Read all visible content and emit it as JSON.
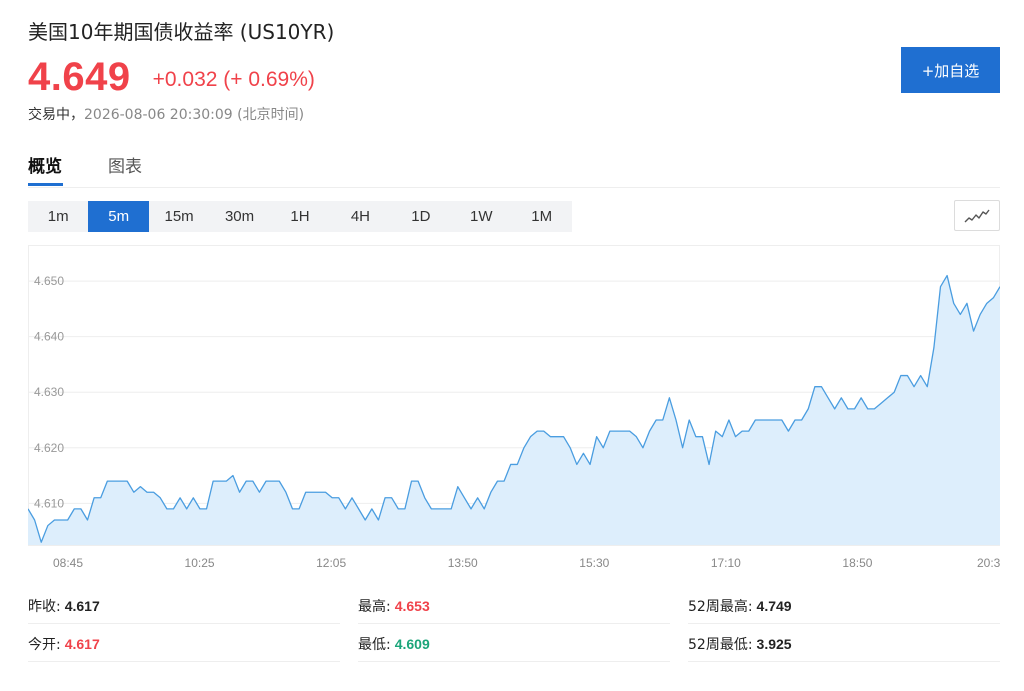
{
  "header": {
    "title": "美国10年期国债收益率 (US10YR)",
    "price": "4.649",
    "change": "+0.032 (+ 0.69%)",
    "status": "交易中，",
    "timestamp": "2026-08-06 20:30:09 (北京时间)",
    "add_button": "+加自选"
  },
  "tabs": [
    {
      "label": "概览",
      "active": true
    },
    {
      "label": "图表",
      "active": false
    }
  ],
  "ranges": [
    {
      "label": "1m",
      "active": false
    },
    {
      "label": "5m",
      "active": true
    },
    {
      "label": "15m",
      "active": false
    },
    {
      "label": "30m",
      "active": false
    },
    {
      "label": "1H",
      "active": false
    },
    {
      "label": "4H",
      "active": false
    },
    {
      "label": "1D",
      "active": false
    },
    {
      "label": "1W",
      "active": false
    },
    {
      "label": "1M",
      "active": false
    }
  ],
  "chart_type_icon": "line-chart-icon",
  "colors": {
    "accent": "#1f6fd1",
    "up": "#f0424a",
    "down": "#1ba57a",
    "line": "#4a9de0",
    "area": "#ddeefc"
  },
  "chart_data": {
    "type": "area",
    "ylim": [
      4.6025,
      4.6565
    ],
    "y_ticks": [
      "4.610",
      "4.620",
      "4.630",
      "4.640",
      "4.650"
    ],
    "x_ticks": [
      "08:45",
      "10:25",
      "12:05",
      "13:50",
      "15:30",
      "17:10",
      "18:50",
      "20:3"
    ],
    "grid": true,
    "series": [
      {
        "values": [
          4.609,
          4.607,
          4.603,
          4.606,
          4.607,
          4.607,
          4.607,
          4.609,
          4.609,
          4.607,
          4.611,
          4.611,
          4.614,
          4.614,
          4.614,
          4.614,
          4.612,
          4.613,
          4.612,
          4.612,
          4.611,
          4.609,
          4.609,
          4.611,
          4.609,
          4.611,
          4.609,
          4.609,
          4.614,
          4.614,
          4.614,
          4.615,
          4.612,
          4.614,
          4.614,
          4.612,
          4.614,
          4.614,
          4.614,
          4.612,
          4.609,
          4.609,
          4.612,
          4.612,
          4.612,
          4.612,
          4.611,
          4.611,
          4.609,
          4.611,
          4.609,
          4.607,
          4.609,
          4.607,
          4.611,
          4.611,
          4.609,
          4.609,
          4.614,
          4.614,
          4.611,
          4.609,
          4.609,
          4.609,
          4.609,
          4.613,
          4.611,
          4.609,
          4.611,
          4.609,
          4.612,
          4.614,
          4.614,
          4.617,
          4.617,
          4.62,
          4.622,
          4.623,
          4.623,
          4.622,
          4.622,
          4.622,
          4.62,
          4.617,
          4.619,
          4.617,
          4.622,
          4.62,
          4.623,
          4.623,
          4.623,
          4.623,
          4.622,
          4.62,
          4.623,
          4.625,
          4.625,
          4.629,
          4.625,
          4.62,
          4.625,
          4.622,
          4.622,
          4.617,
          4.623,
          4.622,
          4.625,
          4.622,
          4.623,
          4.623,
          4.625,
          4.625,
          4.625,
          4.625,
          4.625,
          4.623,
          4.625,
          4.625,
          4.627,
          4.631,
          4.631,
          4.629,
          4.627,
          4.629,
          4.627,
          4.627,
          4.629,
          4.627,
          4.627,
          4.628,
          4.629,
          4.63,
          4.633,
          4.633,
          4.631,
          4.633,
          4.631,
          4.638,
          4.649,
          4.651,
          4.646,
          4.644,
          4.646,
          4.641,
          4.644,
          4.646,
          4.647,
          4.649
        ]
      }
    ]
  },
  "stats": [
    {
      "label": "昨收:",
      "value": "4.617",
      "tone": "neutral"
    },
    {
      "label": "最高:",
      "value": "4.653",
      "tone": "up"
    },
    {
      "label": "52周最高:",
      "value": "4.749",
      "tone": "neutral"
    },
    {
      "label": "今开:",
      "value": "4.617",
      "tone": "up"
    },
    {
      "label": "最低:",
      "value": "4.609",
      "tone": "down"
    },
    {
      "label": "52周最低:",
      "value": "3.925",
      "tone": "neutral"
    }
  ]
}
